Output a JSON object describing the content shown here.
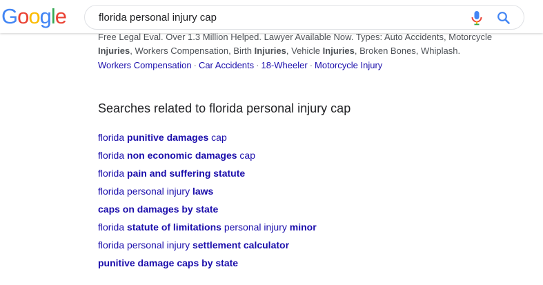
{
  "logo": {
    "letters": [
      {
        "char": "G",
        "color": "#4285F4"
      },
      {
        "char": "o",
        "color": "#EA4335"
      },
      {
        "char": "o",
        "color": "#FBBC05"
      },
      {
        "char": "g",
        "color": "#4285F4"
      },
      {
        "char": "l",
        "color": "#34A853"
      },
      {
        "char": "e",
        "color": "#EA4335"
      }
    ]
  },
  "search": {
    "query": "florida personal injury cap",
    "mic_icon": "microphone-icon",
    "search_icon": "magnifier-icon"
  },
  "ad": {
    "snippet": [
      {
        "text": "Free Legal Eval. Over 1.3 Million Helped. Lawyer Available Now. Types: Auto Accidents, Motorcycle ",
        "bold": false
      },
      {
        "text": "Injuries",
        "bold": true
      },
      {
        "text": ", Workers Compensation, Birth ",
        "bold": false
      },
      {
        "text": "Injuries",
        "bold": true
      },
      {
        "text": ", Vehicle ",
        "bold": false
      },
      {
        "text": "Injuries",
        "bold": true
      },
      {
        "text": ", Broken Bones, Whiplash.",
        "bold": false
      }
    ],
    "sitelinks": [
      "Workers Compensation",
      "Car Accidents",
      "18-Wheeler",
      "Motorcycle Injury"
    ],
    "separator": "·"
  },
  "related": {
    "title": "Searches related to florida personal injury cap",
    "items": [
      [
        {
          "text": "florida ",
          "bold": false
        },
        {
          "text": "punitive damages",
          "bold": true
        },
        {
          "text": " cap",
          "bold": false
        }
      ],
      [
        {
          "text": "florida ",
          "bold": false
        },
        {
          "text": "non economic damages",
          "bold": true
        },
        {
          "text": " cap",
          "bold": false
        }
      ],
      [
        {
          "text": "florida ",
          "bold": false
        },
        {
          "text": "pain and suffering statute",
          "bold": true
        }
      ],
      [
        {
          "text": "florida personal injury ",
          "bold": false
        },
        {
          "text": "laws",
          "bold": true
        }
      ],
      [
        {
          "text": "caps on damages by state",
          "bold": true
        }
      ],
      [
        {
          "text": "florida ",
          "bold": false
        },
        {
          "text": "statute of limitations",
          "bold": true
        },
        {
          "text": " personal injury ",
          "bold": false
        },
        {
          "text": "minor",
          "bold": true
        }
      ],
      [
        {
          "text": "florida personal injury ",
          "bold": false
        },
        {
          "text": "settlement calculator",
          "bold": true
        }
      ],
      [
        {
          "text": "punitive damage caps by state",
          "bold": true
        }
      ]
    ]
  },
  "colors": {
    "link": "#1a0dab",
    "snippet_text": "#4d5156",
    "mic_blue": "#4285F4",
    "mic_red": "#EA4335",
    "mic_yellow": "#FBBC05",
    "mic_green": "#34A853"
  }
}
